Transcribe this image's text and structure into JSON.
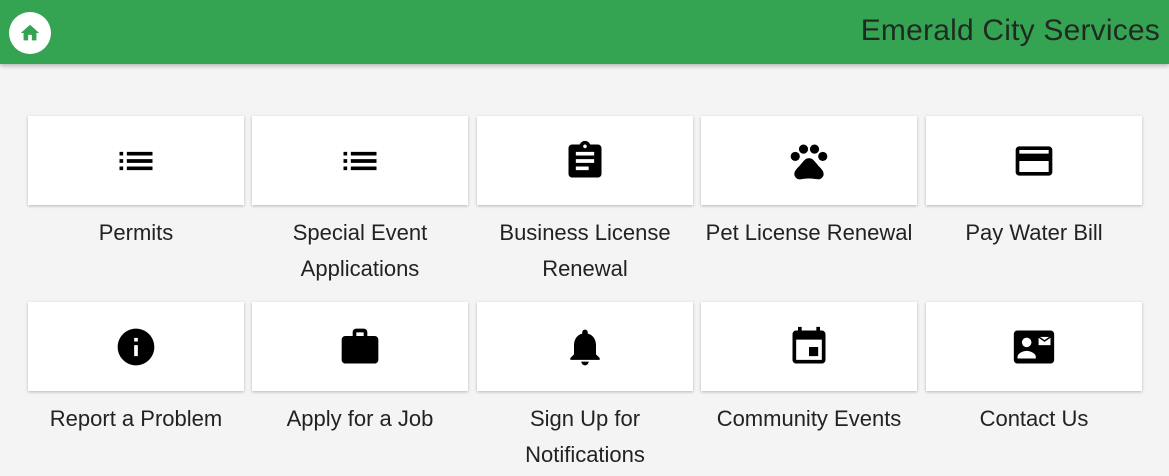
{
  "header": {
    "title": "Emerald City Services",
    "home_icon": "home-icon",
    "bar_color": "#34a352"
  },
  "tiles": [
    {
      "label": "Permits",
      "icon": "list-icon"
    },
    {
      "label": "Special Event Applications",
      "icon": "list-icon"
    },
    {
      "label": "Business License Renewal",
      "icon": "clipboard-icon"
    },
    {
      "label": "Pet License Renewal",
      "icon": "paw-icon"
    },
    {
      "label": "Pay Water Bill",
      "icon": "credit-card-icon"
    },
    {
      "label": "Report a Problem",
      "icon": "info-icon"
    },
    {
      "label": "Apply for a Job",
      "icon": "briefcase-icon"
    },
    {
      "label": "Sign Up for Notifications",
      "icon": "bell-icon"
    },
    {
      "label": "Community Events",
      "icon": "calendar-icon"
    },
    {
      "label": "Contact Us",
      "icon": "contact-card-icon"
    }
  ]
}
